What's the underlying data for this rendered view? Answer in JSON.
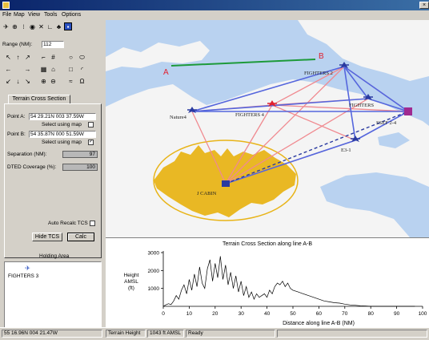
{
  "menu": [
    "File",
    "Map",
    "View",
    "Tools",
    "Options"
  ],
  "range": {
    "label": "Range (NM):",
    "value": "112"
  },
  "tabs": {
    "active": "Terrain Cross Section"
  },
  "tcs": {
    "point_a_label": "Point A:",
    "point_a_value": "54 29.21N 003 37.59W",
    "point_b_label": "Point B:",
    "point_b_value": "54 35.87N 000 51.59W",
    "select_map_label": "Select using map",
    "separation_label": "Separation (NM):",
    "separation_value": "97",
    "dted_label": "DTED Coverage (%):",
    "dted_value": "100",
    "auto_recalc_label": "Auto Recalc TCS",
    "hide_tcs_label": "Hide TCS",
    "calc_label": "Calc"
  },
  "holding": {
    "title": "Holding Area",
    "item": "FIGHTERS 3"
  },
  "map": {
    "point_a": "A",
    "point_b": "B",
    "labels": [
      "FIGHTERS 2",
      "FIGHTERS",
      "Nature4",
      "FIGHTERS 4",
      "SSEF 2-4",
      "E3-1",
      "J CABIN"
    ],
    "colors": {
      "sea": "#b9d2f0",
      "land": "#f4f4f4",
      "coverage": "#e8b418",
      "ring": "#e8b418",
      "link": "#5566dd",
      "threat": "#f08a90",
      "tcs_line": "#1d9a3a"
    }
  },
  "status": {
    "coords": "55 16.96N 004 21.47W",
    "terrain_height_label": "Terrain Height",
    "terrain_height_value": "1043 ft AMSL",
    "ready": "Ready"
  },
  "chart_data": {
    "type": "area",
    "title": "Terrain Cross Section along line A-B",
    "xlabel": "Distance along line A-B (NM)",
    "ylabel": "Height AMSL (ft)",
    "xlim": [
      0,
      100
    ],
    "ylim": [
      0,
      3000
    ],
    "x_ticks": [
      0,
      10,
      20,
      30,
      40,
      50,
      60,
      70,
      80,
      90,
      100
    ],
    "y_ticks": [
      1000,
      2000,
      3000
    ],
    "series": [
      {
        "x": [
          0,
          1,
          2,
          3,
          4,
          5,
          6,
          7,
          8,
          9,
          10,
          11,
          12,
          13,
          14,
          15,
          16,
          17,
          18,
          19,
          20,
          21,
          22,
          23,
          24,
          25,
          26,
          27,
          28,
          29,
          30,
          31,
          32,
          33,
          34,
          35,
          36,
          37,
          38,
          39,
          40,
          41,
          42,
          43,
          44,
          45,
          46,
          47,
          48,
          49,
          50,
          52,
          54,
          56,
          58,
          60,
          62,
          64,
          66,
          68,
          70,
          72,
          74,
          76,
          78,
          80,
          82,
          84,
          86,
          88,
          90,
          92,
          94,
          96,
          97
        ],
        "y": [
          0,
          80,
          150,
          100,
          300,
          600,
          400,
          900,
          1200,
          700,
          1500,
          900,
          1800,
          1100,
          2200,
          1300,
          1000,
          2100,
          2600,
          1400,
          2400,
          1600,
          2800,
          1500,
          2300,
          1200,
          1900,
          1000,
          1700,
          800,
          1400,
          600,
          1100,
          500,
          800,
          400,
          700,
          500,
          600,
          700,
          500,
          900,
          700,
          1100,
          1300,
          1200,
          1400,
          1100,
          1300,
          1000,
          900,
          800,
          700,
          600,
          500,
          400,
          300,
          250,
          200,
          180,
          120,
          80,
          60,
          30,
          20,
          0,
          0,
          0,
          0,
          0,
          0,
          0,
          0,
          0,
          0
        ]
      }
    ]
  }
}
